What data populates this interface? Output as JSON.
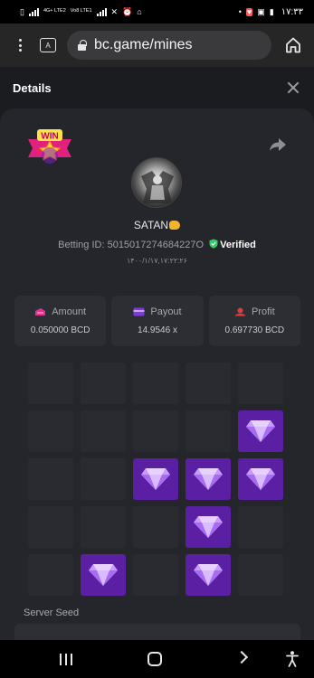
{
  "status_bar": {
    "left_tags": [
      "4G+ LTE2",
      "Vo8 LTE1"
    ],
    "time": "۱۷:۳۳"
  },
  "browser": {
    "tab_count": "A",
    "url": "bc.game/mines"
  },
  "details": {
    "title": "Details",
    "badge_text": "WIN",
    "username": "SATAN",
    "betting_id_label": "Betting ID:",
    "betting_id": "5015017274684227O",
    "verified_label": "Verified",
    "bet_time": "۱۴۰۰/۱/۱۷,۱۷:۲۲:۲۶"
  },
  "stats": [
    {
      "label": "Amount",
      "value": "0.050000 BCD",
      "icon": "amount-icon"
    },
    {
      "label": "Payout",
      "value": "14.9546 x",
      "icon": "payout-icon"
    },
    {
      "label": "Profit",
      "value": "0.697730 BCD",
      "icon": "profit-icon"
    }
  ],
  "mines_grid": {
    "rows": 5,
    "cols": 5,
    "revealed_gems": [
      [
        1,
        4
      ],
      [
        2,
        2
      ],
      [
        2,
        3
      ],
      [
        2,
        4
      ],
      [
        3,
        3
      ],
      [
        4,
        1
      ],
      [
        4,
        3
      ]
    ]
  },
  "server_seed": {
    "label": "Server Seed"
  },
  "colors": {
    "gem_tile": "#5b1fa3",
    "empty_tile": "#2a2b30",
    "verified_green": "#2fce67"
  }
}
